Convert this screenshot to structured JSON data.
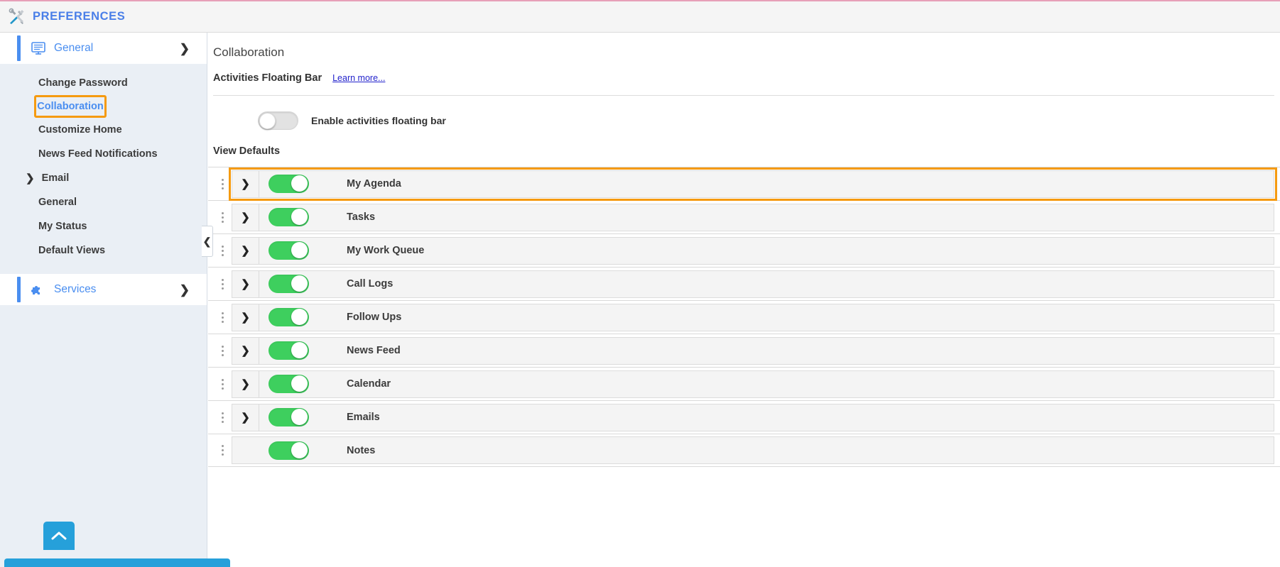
{
  "header": {
    "title": "PREFERENCES",
    "icon": "tools-icon"
  },
  "sidebar": {
    "sections": [
      {
        "label": "General",
        "icon": "monitor-icon",
        "chevron": "❯"
      }
    ],
    "items": [
      {
        "label": "Change Password",
        "active": false
      },
      {
        "label": "Collaboration",
        "active": true
      },
      {
        "label": "Customize Home",
        "active": false
      },
      {
        "label": "News Feed Notifications",
        "active": false
      }
    ],
    "group": {
      "label": "Email",
      "chevron": "❯"
    },
    "group_items": [
      {
        "label": "General"
      },
      {
        "label": "My Status"
      },
      {
        "label": "Default Views"
      }
    ],
    "services": {
      "label": "Services",
      "icon": "puzzle-icon",
      "chevron": "❯"
    },
    "collapse_handle": "❮",
    "scroll_top": "chevron-up-icon",
    "highlight_color": "#f59a10",
    "accent_color": "#4a8ef0"
  },
  "main": {
    "page_title": "Collaboration",
    "floating_bar": {
      "heading": "Activities Floating Bar",
      "learn_more": "Learn more...",
      "toggle_label": "Enable activities floating bar",
      "toggle_state": "off"
    },
    "view_defaults": {
      "heading": "View Defaults",
      "rows": [
        {
          "label": "My Agenda",
          "toggle_state": "on",
          "expandable": true,
          "highlighted": true
        },
        {
          "label": "Tasks",
          "toggle_state": "on",
          "expandable": true,
          "highlighted": false
        },
        {
          "label": "My Work Queue",
          "toggle_state": "on",
          "expandable": true,
          "highlighted": false
        },
        {
          "label": "Call Logs",
          "toggle_state": "on",
          "expandable": true,
          "highlighted": false
        },
        {
          "label": "Follow Ups",
          "toggle_state": "on",
          "expandable": true,
          "highlighted": false
        },
        {
          "label": "News Feed",
          "toggle_state": "on",
          "expandable": true,
          "highlighted": false
        },
        {
          "label": "Calendar",
          "toggle_state": "on",
          "expandable": true,
          "highlighted": false
        },
        {
          "label": "Emails",
          "toggle_state": "on",
          "expandable": true,
          "highlighted": false
        },
        {
          "label": "Notes",
          "toggle_state": "on",
          "expandable": false,
          "highlighted": false
        }
      ],
      "expander_icon": "❯",
      "toggle_on_color": "#3ecf5e",
      "toggle_off_color": "#e2e2e2"
    }
  }
}
